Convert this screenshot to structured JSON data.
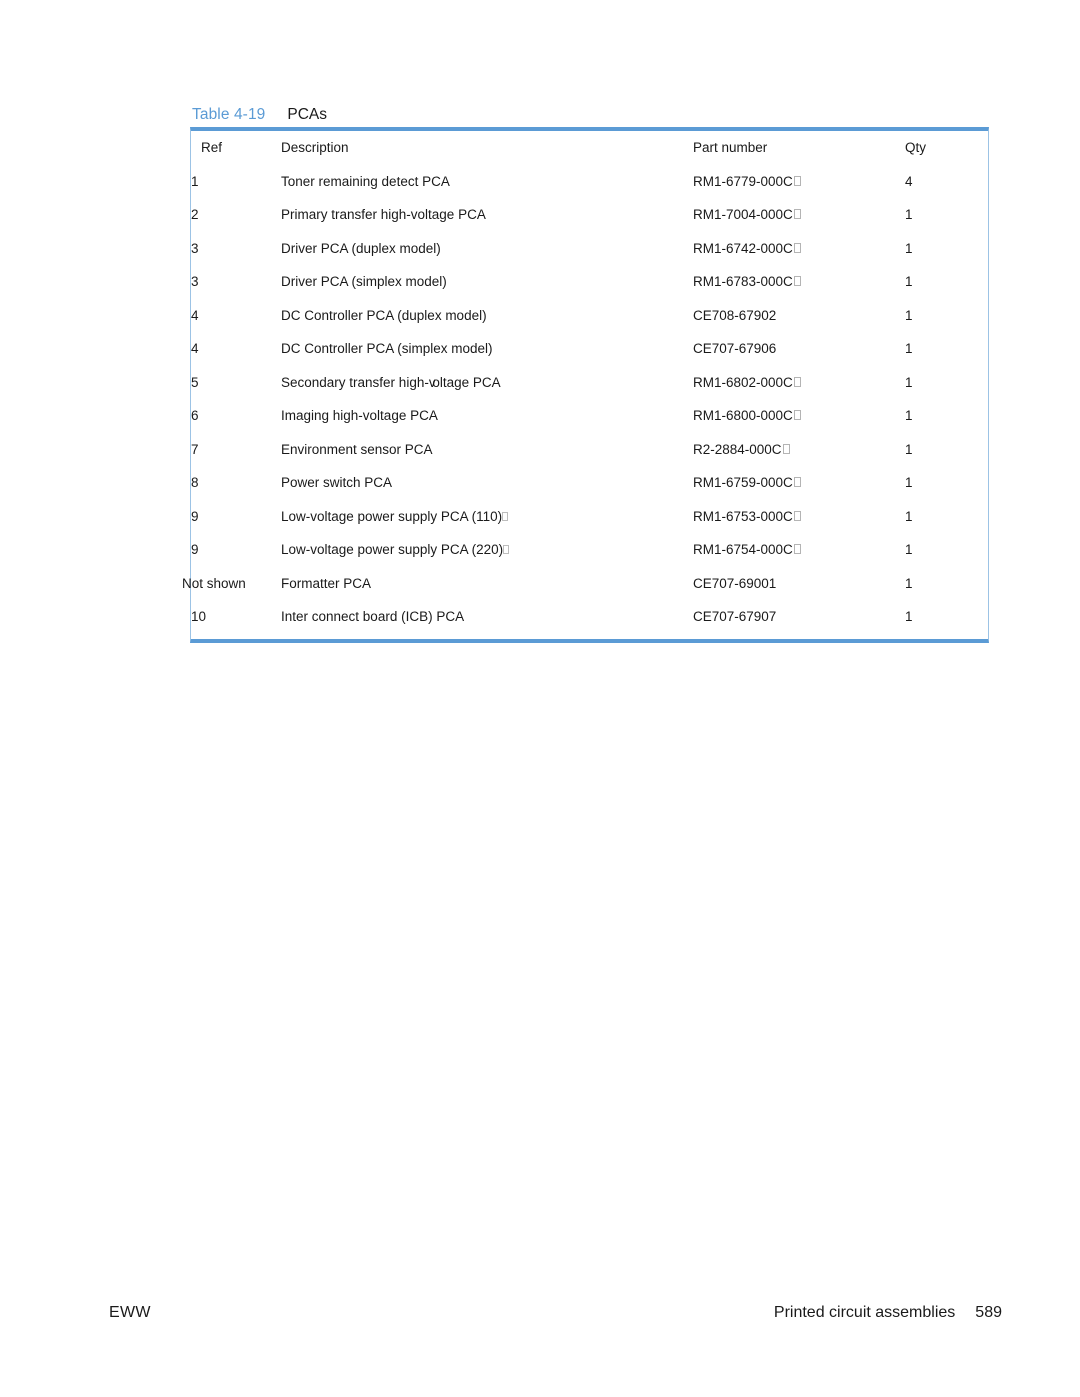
{
  "caption": {
    "label": "Table 4-19",
    "title": "PCAs",
    "label_color": "#5b9bd5"
  },
  "table": {
    "border_color": "#5b9bd5",
    "headers": {
      "ref": "Ref",
      "description": "Description",
      "part_number": "Part number",
      "qty": "Qty"
    },
    "rows": [
      {
        "ref": "1",
        "description": "Toner remaining detect PCA",
        "part_number": "RM1-6779-000C",
        "part_suffix_glyph": "missing-glyph-box",
        "qty": "4"
      },
      {
        "ref": "2",
        "description": "Primary transfer high-voltage PCA",
        "part_number": "RM1-7004-000C",
        "part_suffix_glyph": "missing-glyph-box",
        "qty": "1"
      },
      {
        "ref": "3",
        "description": "Driver PCA (duplex model)",
        "part_number": "RM1-6742-000C",
        "part_suffix_glyph": "missing-glyph-box",
        "qty": "1"
      },
      {
        "ref": "3",
        "description": "Driver PCA (simplex model)",
        "part_number": "RM1-6783-000C",
        "part_suffix_glyph": "missing-glyph-box",
        "qty": "1"
      },
      {
        "ref": "4",
        "description": "DC Controller PCA (duplex model)",
        "part_number": "CE708-67902",
        "part_suffix_glyph": "",
        "qty": "1"
      },
      {
        "ref": "4",
        "description": "DC Controller PCA (simplex model)",
        "part_number": "CE707-67906",
        "part_suffix_glyph": "",
        "qty": "1"
      },
      {
        "ref": "5",
        "description": "Secondary transfer high-voltage PCA",
        "part_number": "RM1-6802-000C",
        "part_suffix_glyph": "missing-glyph-box",
        "qty": "1"
      },
      {
        "ref": "6",
        "description": "Imaging high-voltage PCA",
        "part_number": "RM1-6800-000C",
        "part_suffix_glyph": "missing-glyph-box",
        "qty": "1"
      },
      {
        "ref": "7",
        "description": "Environment sensor PCA",
        "part_number": "R2-2884-000C",
        "part_suffix_glyph": "missing-glyph-box",
        "qty": "1"
      },
      {
        "ref": "8",
        "description": "Power switch PCA",
        "part_number": "RM1-6759-000C",
        "part_suffix_glyph": "missing-glyph-box",
        "qty": "1"
      },
      {
        "ref": "9",
        "description": "Low-voltage power supply PCA (110)",
        "desc_suffix_glyph": "missing-glyph-box",
        "part_number": "RM1-6753-000C",
        "part_suffix_glyph": "missing-glyph-box",
        "qty": "1"
      },
      {
        "ref": "9",
        "description": "Low-voltage power supply PCA (220)",
        "desc_suffix_glyph": "missing-glyph-box",
        "part_number": "RM1-6754-000C",
        "part_suffix_glyph": "missing-glyph-box",
        "qty": "1"
      },
      {
        "ref": "Not shown",
        "description": "Formatter PCA",
        "part_number": "CE707-69001",
        "part_suffix_glyph": "",
        "qty": "1"
      },
      {
        "ref": "10",
        "description": "Inter connect board (ICB) PCA",
        "part_number": "CE707-67907",
        "part_suffix_glyph": "",
        "qty": "1"
      }
    ]
  },
  "footer": {
    "left": "EWW",
    "section": "Printed circuit assemblies",
    "page_number": "589"
  }
}
